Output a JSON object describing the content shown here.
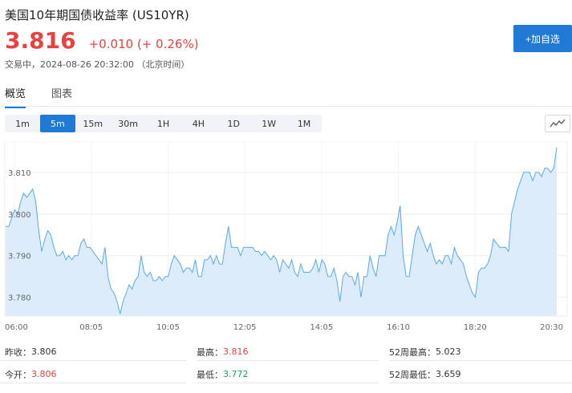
{
  "header": {
    "title": "美国10年期国债收益率  (US10YR)",
    "price": "3.816",
    "change": "+0.010 (+ 0.26%)",
    "status": "交易中，2024-08-26 20:32:00 （北京时间）",
    "add_button": "+加自选",
    "price_color": "#e8413e",
    "accent_color": "#1f7ad6"
  },
  "tabs": [
    {
      "label": "概览",
      "active": true
    },
    {
      "label": "图表",
      "active": false
    }
  ],
  "periods": [
    {
      "label": "1m",
      "active": false
    },
    {
      "label": "5m",
      "active": true
    },
    {
      "label": "15m",
      "active": false
    },
    {
      "label": "30m",
      "active": false
    },
    {
      "label": "1H",
      "active": false
    },
    {
      "label": "4H",
      "active": false
    },
    {
      "label": "1D",
      "active": false
    },
    {
      "label": "1W",
      "active": false
    },
    {
      "label": "1M",
      "active": false
    }
  ],
  "chart_toggle_icon": "line-chart-icon",
  "chart_data": {
    "type": "area",
    "x_ticks": [
      "06:00",
      "08:05",
      "10:05",
      "12:05",
      "14:05",
      "16:10",
      "18:20",
      "20:30"
    ],
    "y_ticks": [
      3.78,
      3.79,
      3.8,
      3.81
    ],
    "y_tick_labels": [
      "3.780",
      "3.790",
      "3.800",
      "3.810"
    ],
    "ylim": [
      3.7755,
      3.8175
    ],
    "grid": true,
    "line_color": "#5aa9e6",
    "fill_color": "#dcecfb",
    "values": [
      3.797,
      3.797,
      3.799,
      3.801,
      3.8,
      3.803,
      3.805,
      3.804,
      3.805,
      3.806,
      3.803,
      3.796,
      3.791,
      3.794,
      3.796,
      3.795,
      3.792,
      3.79,
      3.79,
      3.791,
      3.789,
      3.79,
      3.789,
      3.79,
      3.79,
      3.793,
      3.794,
      3.792,
      3.792,
      3.791,
      3.79,
      3.789,
      3.788,
      3.792,
      3.785,
      3.782,
      3.781,
      3.779,
      3.776,
      3.779,
      3.781,
      3.783,
      3.782,
      3.784,
      3.785,
      3.79,
      3.786,
      3.785,
      3.786,
      3.784,
      3.784,
      3.785,
      3.784,
      3.785,
      3.785,
      3.788,
      3.79,
      3.789,
      3.788,
      3.786,
      3.787,
      3.787,
      3.786,
      3.789,
      3.785,
      3.785,
      3.789,
      3.789,
      3.79,
      3.788,
      3.79,
      3.788,
      3.788,
      3.793,
      3.797,
      3.792,
      3.792,
      3.792,
      3.79,
      3.792,
      3.792,
      3.792,
      3.792,
      3.791,
      3.791,
      3.79,
      3.791,
      3.79,
      3.789,
      3.79,
      3.789,
      3.786,
      3.789,
      3.788,
      3.787,
      3.789,
      3.786,
      3.785,
      3.788,
      3.786,
      3.786,
      3.786,
      3.787,
      3.789,
      3.786,
      3.789,
      3.788,
      3.785,
      3.785,
      3.787,
      3.784,
      3.779,
      3.785,
      3.786,
      3.785,
      3.785,
      3.783,
      3.786,
      3.78,
      3.785,
      3.785,
      3.79,
      3.787,
      3.785,
      3.79,
      3.79,
      3.79,
      3.795,
      3.797,
      3.795,
      3.798,
      3.802,
      3.79,
      3.785,
      3.785,
      3.79,
      3.795,
      3.797,
      3.795,
      3.793,
      3.791,
      3.793,
      3.79,
      3.788,
      3.789,
      3.788,
      3.79,
      3.79,
      3.788,
      3.792,
      3.79,
      3.789,
      3.788,
      3.785,
      3.783,
      3.781,
      3.78,
      3.786,
      3.787,
      3.787,
      3.788,
      3.79,
      3.794,
      3.793,
      3.792,
      3.792,
      3.792,
      3.791,
      3.8,
      3.803,
      3.806,
      3.808,
      3.81,
      3.81,
      3.81,
      3.808,
      3.81,
      3.81,
      3.809,
      3.811,
      3.811,
      3.81,
      3.811,
      3.816
    ]
  },
  "stats": [
    [
      {
        "label": "昨收：",
        "value": "3.806",
        "color": ""
      },
      {
        "label": "最高：",
        "value": "3.816",
        "color": "red"
      },
      {
        "label": "52周最高：",
        "value": "5.023",
        "color": ""
      }
    ],
    [
      {
        "label": "今开：",
        "value": "3.806",
        "color": "red"
      },
      {
        "label": "最低：",
        "value": "3.772",
        "color": "green"
      },
      {
        "label": "52周最低：",
        "value": "3.659",
        "color": ""
      }
    ]
  ]
}
